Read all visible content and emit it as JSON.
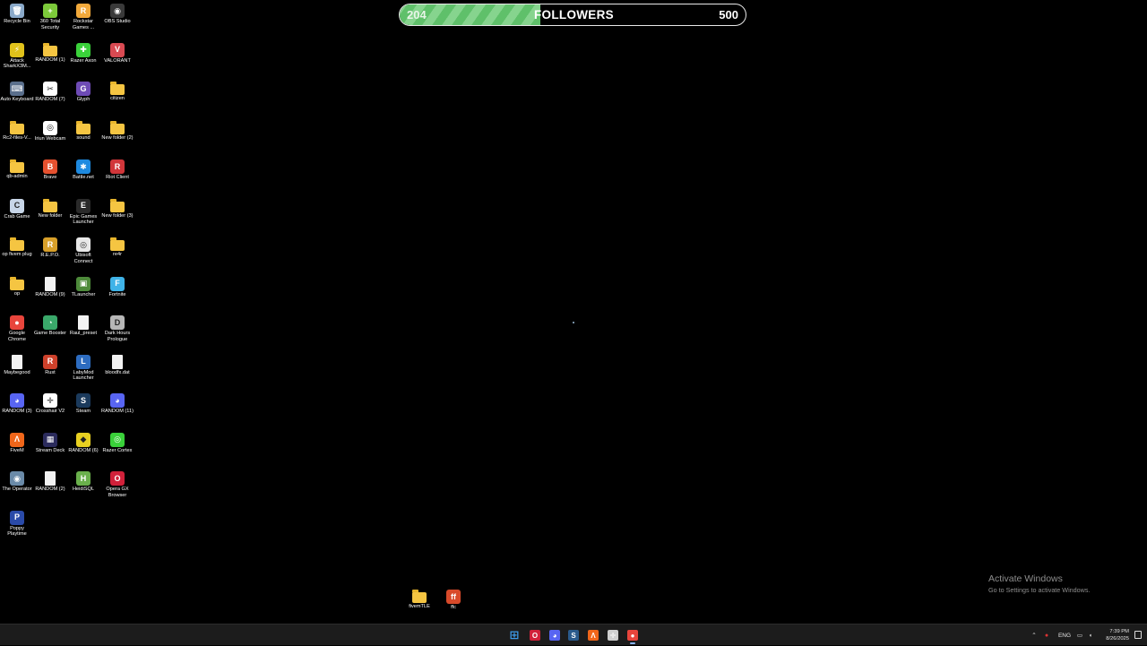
{
  "desktop": {
    "icons": [
      {
        "label": "Recycle Bin",
        "kind": "app",
        "color": "#8aa9c9",
        "glyph": "🗑",
        "col": 0,
        "row": 0
      },
      {
        "label": "360 Total Security",
        "kind": "app",
        "color": "#7cc93a",
        "glyph": "+",
        "col": 1,
        "row": 0
      },
      {
        "label": "Rockstar Games ...",
        "kind": "app",
        "color": "#f2a93b",
        "glyph": "R",
        "col": 2,
        "row": 0
      },
      {
        "label": "OBS Studio",
        "kind": "app",
        "color": "#3a3a3a",
        "glyph": "◉",
        "col": 3,
        "row": 0
      },
      {
        "label": "Attack SharkX3M...",
        "kind": "app",
        "color": "#e0c21b",
        "glyph": "⚡",
        "col": 0,
        "row": 1
      },
      {
        "label": "RANDOM (1)",
        "kind": "folder",
        "col": 1,
        "row": 1
      },
      {
        "label": "Razer Axon",
        "kind": "app",
        "color": "#3ad13a",
        "glyph": "✚",
        "col": 2,
        "row": 1
      },
      {
        "label": "VALORANT",
        "kind": "app",
        "color": "#d94a52",
        "glyph": "V",
        "col": 3,
        "row": 1
      },
      {
        "label": "Auto Keyboard",
        "kind": "app",
        "color": "#5a6f8c",
        "glyph": "⌨",
        "col": 0,
        "row": 2
      },
      {
        "label": "RANDOM (7)",
        "kind": "app",
        "color": "#ffffff",
        "glyph": "✂",
        "col": 1,
        "row": 2
      },
      {
        "label": "Glyph",
        "kind": "app",
        "color": "#6e4bb5",
        "glyph": "G",
        "col": 2,
        "row": 2
      },
      {
        "label": "citizen",
        "kind": "folder",
        "col": 3,
        "row": 2
      },
      {
        "label": "Rc2-files-V...",
        "kind": "folder",
        "col": 0,
        "row": 3
      },
      {
        "label": "Iriun Webcam",
        "kind": "app",
        "color": "#ffffff",
        "glyph": "◎",
        "col": 1,
        "row": 3
      },
      {
        "label": "sound",
        "kind": "folder",
        "col": 2,
        "row": 3
      },
      {
        "label": "New folder (2)",
        "kind": "folder",
        "col": 3,
        "row": 3
      },
      {
        "label": "qb-admin",
        "kind": "folder",
        "col": 0,
        "row": 4
      },
      {
        "label": "Brave",
        "kind": "app",
        "color": "#e5512f",
        "glyph": "B",
        "col": 1,
        "row": 4
      },
      {
        "label": "Battle.net",
        "kind": "app",
        "color": "#1e8ae0",
        "glyph": "✱",
        "col": 2,
        "row": 4
      },
      {
        "label": "Riot Client",
        "kind": "app",
        "color": "#d1363a",
        "glyph": "R",
        "col": 3,
        "row": 4
      },
      {
        "label": "Crab Game",
        "kind": "app",
        "color": "#c8d6e8",
        "glyph": "C",
        "col": 0,
        "row": 5
      },
      {
        "label": "New folder",
        "kind": "folder",
        "col": 1,
        "row": 5
      },
      {
        "label": "Epic Games Launcher",
        "kind": "app",
        "color": "#2a2a2a",
        "glyph": "E",
        "col": 2,
        "row": 5
      },
      {
        "label": "New folder (3)",
        "kind": "folder",
        "col": 3,
        "row": 5
      },
      {
        "label": "op fivem plug",
        "kind": "folder",
        "col": 0,
        "row": 6
      },
      {
        "label": "R.E.P.O.",
        "kind": "app",
        "color": "#d8a02a",
        "glyph": "R",
        "col": 1,
        "row": 6
      },
      {
        "label": "Ubisoft Connect",
        "kind": "app",
        "color": "#e8e8e8",
        "glyph": "◎",
        "col": 2,
        "row": 6
      },
      {
        "label": "re4r",
        "kind": "folder",
        "col": 3,
        "row": 6
      },
      {
        "label": "op",
        "kind": "folder",
        "col": 0,
        "row": 7
      },
      {
        "label": "RANDOM (9)",
        "kind": "file",
        "col": 1,
        "row": 7
      },
      {
        "label": "TLauncher",
        "kind": "app",
        "color": "#4d8a3a",
        "glyph": "▣",
        "col": 2,
        "row": 7
      },
      {
        "label": "Fortnite",
        "kind": "app",
        "color": "#3fb3e8",
        "glyph": "F",
        "col": 3,
        "row": 7
      },
      {
        "label": "Google Chrome",
        "kind": "app",
        "color": "#e8453c",
        "glyph": "●",
        "col": 0,
        "row": 8
      },
      {
        "label": "Game Booster",
        "kind": "app",
        "color": "#3aa86a",
        "glyph": "◔",
        "col": 1,
        "row": 8
      },
      {
        "label": "Raul_preset",
        "kind": "file",
        "col": 2,
        "row": 8
      },
      {
        "label": "Dark Hours Prologue",
        "kind": "app",
        "color": "#b7b7b7",
        "glyph": "D",
        "col": 3,
        "row": 8
      },
      {
        "label": "Maybegood",
        "kind": "file",
        "col": 0,
        "row": 9
      },
      {
        "label": "Rust",
        "kind": "app",
        "color": "#cd412b",
        "glyph": "R",
        "col": 1,
        "row": 9
      },
      {
        "label": "LabyMod Launcher",
        "kind": "app",
        "color": "#2d6cc0",
        "glyph": "L",
        "col": 2,
        "row": 9
      },
      {
        "label": "bloodfx.dat",
        "kind": "file",
        "col": 3,
        "row": 9
      },
      {
        "label": "RANDOM (3)",
        "kind": "app",
        "color": "#5865f2",
        "glyph": "◕",
        "col": 0,
        "row": 10
      },
      {
        "label": "Crosshair V2",
        "kind": "app",
        "color": "#ffffff",
        "glyph": "✛",
        "col": 1,
        "row": 10
      },
      {
        "label": "Steam",
        "kind": "app",
        "color": "#1b3a5c",
        "glyph": "S",
        "col": 2,
        "row": 10
      },
      {
        "label": "RANDOM (11)",
        "kind": "app",
        "color": "#5865f2",
        "glyph": "◕",
        "col": 3,
        "row": 10
      },
      {
        "label": "FiveM",
        "kind": "app",
        "color": "#f0661a",
        "glyph": "Λ",
        "col": 0,
        "row": 11
      },
      {
        "label": "Stream Deck",
        "kind": "app",
        "color": "#2b2b5c",
        "glyph": "▦",
        "col": 1,
        "row": 11
      },
      {
        "label": "RANDOM (6)",
        "kind": "app",
        "color": "#e8d021",
        "glyph": "◆",
        "col": 2,
        "row": 11
      },
      {
        "label": "Razer Cortex",
        "kind": "app",
        "color": "#3ad13a",
        "glyph": "◎",
        "col": 3,
        "row": 11
      },
      {
        "label": "The Operator",
        "kind": "app",
        "color": "#6a8aa8",
        "glyph": "◉",
        "col": 0,
        "row": 12
      },
      {
        "label": "RANDOM (2)",
        "kind": "file",
        "col": 1,
        "row": 12
      },
      {
        "label": "HeidiSQL",
        "kind": "app",
        "color": "#6ab04c",
        "glyph": "H",
        "col": 2,
        "row": 12
      },
      {
        "label": "Opera GX Browser",
        "kind": "app",
        "color": "#d1213a",
        "glyph": "O",
        "col": 3,
        "row": 12
      },
      {
        "label": "Poppy Playtime",
        "kind": "app",
        "color": "#2a4aa8",
        "glyph": "P",
        "col": 0,
        "row": 13
      }
    ],
    "bottom_icons": [
      {
        "label": "fivemTLE",
        "kind": "folder"
      },
      {
        "label": "ffc",
        "kind": "app",
        "color": "#d84a2a",
        "glyph": "ff"
      }
    ]
  },
  "goal": {
    "current": "204",
    "title": "FOLLOWERS",
    "target": "500",
    "progress_fraction": 0.408,
    "fill_color": "#6cc874"
  },
  "watermark": {
    "title": "Activate Windows",
    "subtitle": "Go to Settings to activate Windows."
  },
  "taskbar": {
    "apps": [
      {
        "name": "start",
        "glyph": "⊞",
        "color": "#3d9ae8"
      },
      {
        "name": "opera-gx",
        "glyph": "O",
        "color": "#d1213a"
      },
      {
        "name": "discord",
        "glyph": "◕",
        "color": "#5865f2"
      },
      {
        "name": "steam",
        "glyph": "S",
        "color": "#2a5a8c"
      },
      {
        "name": "fivem",
        "glyph": "Λ",
        "color": "#f0661a"
      },
      {
        "name": "crosshair",
        "glyph": "✛",
        "color": "#d0d0d0"
      },
      {
        "name": "chrome",
        "glyph": "●",
        "color": "#e8453c"
      }
    ],
    "tray": {
      "chevron": "⌃",
      "mic": "🎙",
      "language": "ENG"
    },
    "clock": {
      "time": "7:39 PM",
      "date": "8/26/2025"
    }
  }
}
